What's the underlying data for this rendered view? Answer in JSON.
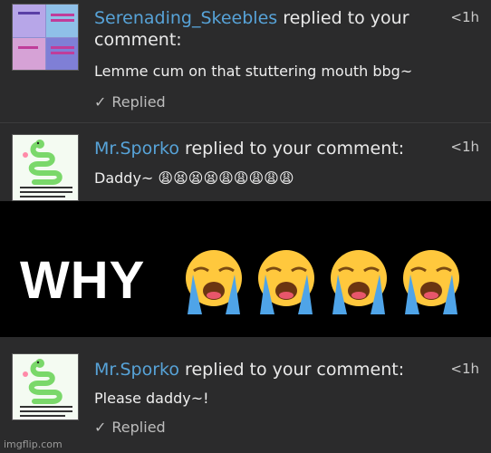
{
  "notifications": [
    {
      "username": "Serenading_Skeebles",
      "action": " replied to your",
      "action2": "comment:",
      "time": "<1h",
      "message": "Lemme cum on that stuttering mouth bbg~",
      "status": "Replied",
      "avatar_icon": "collage-avatar"
    },
    {
      "username": "Mr.Sporko",
      "action": " replied to your comment:",
      "time": "<1h",
      "message": "Daddy~ 😩😫😫😫😩😩😩😩😩",
      "avatar_icon": "snake-avatar"
    },
    {
      "username": "Mr.Sporko",
      "action": " replied to your comment:",
      "time": "<1h",
      "message": "Please daddy~!",
      "status": "Replied",
      "avatar_icon": "snake-avatar"
    }
  ],
  "banner": {
    "text": "WHY"
  },
  "watermark": "imgflip.com",
  "colors": {
    "username": "#57a3d8",
    "background": "#2b2b2c",
    "banner": "#000000"
  }
}
